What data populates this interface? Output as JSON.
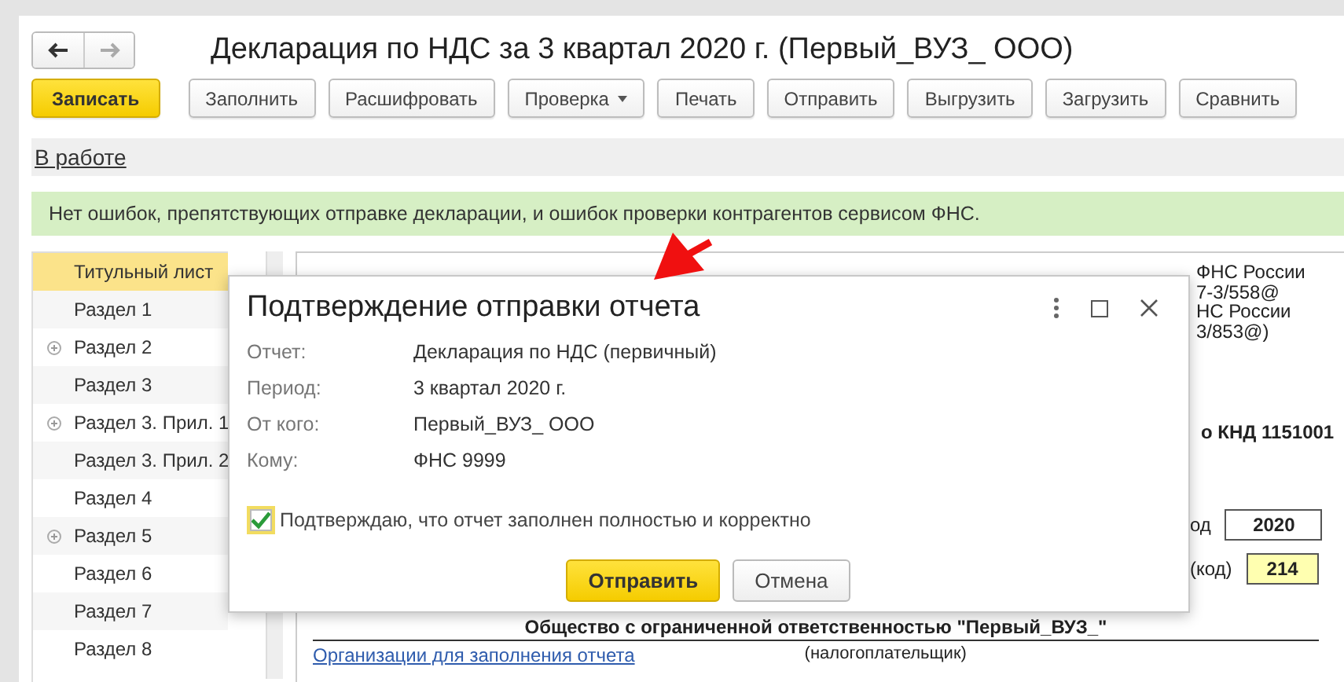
{
  "window": {
    "title": "Декларация по НДС за 3 квартал 2020 г. (Первый_ВУЗ_ ООО)"
  },
  "nav_buttons": [
    {
      "kind": "back",
      "disabled": false
    },
    {
      "kind": "forward",
      "disabled": true
    }
  ],
  "toolbar": [
    {
      "label": "Записать",
      "primary": true,
      "dropdown": false
    },
    {
      "label": "Заполнить",
      "primary": false,
      "dropdown": false
    },
    {
      "label": "Расшифровать",
      "primary": false,
      "dropdown": false
    },
    {
      "label": "Проверка",
      "primary": false,
      "dropdown": true
    },
    {
      "label": "Печать",
      "primary": false,
      "dropdown": false
    },
    {
      "label": "Отправить",
      "primary": false,
      "dropdown": false
    },
    {
      "label": "Выгрузить",
      "primary": false,
      "dropdown": false
    },
    {
      "label": "Загрузить",
      "primary": false,
      "dropdown": false
    },
    {
      "label": "Сравнить",
      "primary": false,
      "dropdown": false
    }
  ],
  "status_link": "В работе",
  "banner": "Нет ошибок, препятствующих отправке декларации, и ошибок проверки контрагентов сервисом ФНС.",
  "sections": [
    {
      "label": "Титульный лист",
      "selected": true,
      "expandable": false
    },
    {
      "label": "Раздел 1",
      "selected": false,
      "expandable": false
    },
    {
      "label": "Раздел 2",
      "selected": false,
      "expandable": true
    },
    {
      "label": "Раздел 3",
      "selected": false,
      "expandable": false
    },
    {
      "label": "Раздел 3. Прил. 1",
      "selected": false,
      "expandable": true
    },
    {
      "label": "Раздел 3. Прил. 2",
      "selected": false,
      "expandable": false
    },
    {
      "label": "Раздел 4",
      "selected": false,
      "expandable": false
    },
    {
      "label": "Раздел 5",
      "selected": false,
      "expandable": true
    },
    {
      "label": "Раздел 6",
      "selected": false,
      "expandable": false
    },
    {
      "label": "Раздел 7",
      "selected": false,
      "expandable": false
    },
    {
      "label": "Раздел 8",
      "selected": false,
      "expandable": false
    }
  ],
  "document": {
    "header_lines": [
      "ФНС России",
      "7-3/558@",
      "НС России",
      "3/853@)"
    ],
    "form_code": "о КНД 1151001",
    "year_label": "од",
    "year": "2020",
    "period_label": "(код)",
    "period": "214",
    "organization": "Общество с ограниченной ответственностью \"Первый_ВУЗ_\"",
    "org_link": "Организации для заполнения отчета",
    "org_caption": "(налогоплательщик)"
  },
  "dialog": {
    "title": "Подтверждение отправки отчета",
    "fields": [
      {
        "label": "Отчет:",
        "value": "Декларация по НДС (первичный)"
      },
      {
        "label": "Период:",
        "value": "3 квартал 2020 г."
      },
      {
        "label": "От кого:",
        "value": "Первый_ВУЗ_ ООО"
      },
      {
        "label": "Кому:",
        "value": "ФНС 9999"
      }
    ],
    "confirm": {
      "label": "Подтверждаю, что отчет заполнен полностью и корректно",
      "checked": true
    },
    "buttons": [
      {
        "label": "Отправить",
        "primary": true
      },
      {
        "label": "Отмена",
        "primary": false
      }
    ]
  }
}
